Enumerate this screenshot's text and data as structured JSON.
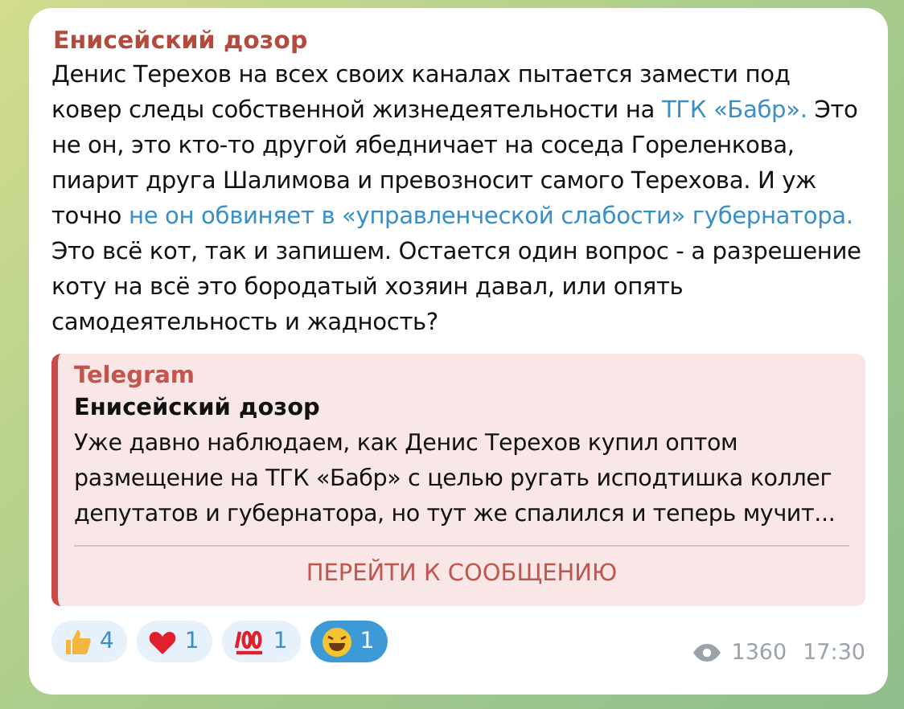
{
  "message": {
    "channel": "Енисейский дозор",
    "segments": [
      {
        "kind": "text",
        "text": "Денис Терехов на всех своих каналах пытается замести под ковер следы собственной жизнедеятельности на"
      },
      {
        "kind": "link",
        "text": "ТГК «Бабр»."
      },
      {
        "kind": "text",
        "text": "Это не он, это кто-то другой ябедничает на соседа Гореленкова, пиарит друга Шалимова и превозносит самого Терехова. И уж точно"
      },
      {
        "kind": "link",
        "text": "не он обвиняет в «управленческой слабости»"
      },
      {
        "kind": "link",
        "text": "губернатора."
      },
      {
        "kind": "text",
        "text": "Это всё кот, так и запишем. Остается один вопрос - а разрешение коту на всё это бородатый хозяин давал, или опять самодеятельность и жадность?"
      }
    ],
    "forward": {
      "source": "Telegram",
      "title": "Енисейский дозор",
      "text": "Уже давно наблюдаем, как Денис Терехов купил оптом размещение на ТГК «Бабр» с целью ругать исподтишка коллег депутатов и губернатора, но тут же спалился и теперь мучит...",
      "button": "ПЕРЕЙТИ К СООБЩЕНИЮ"
    },
    "reactions": [
      {
        "kind": "thumbs",
        "count": "4",
        "selected": false
      },
      {
        "kind": "heart",
        "count": "1",
        "selected": false
      },
      {
        "kind": "hundred",
        "count": "1",
        "selected": false
      },
      {
        "kind": "laugh",
        "count": "1",
        "selected": true
      }
    ],
    "views": "1360",
    "time": "17:30"
  }
}
